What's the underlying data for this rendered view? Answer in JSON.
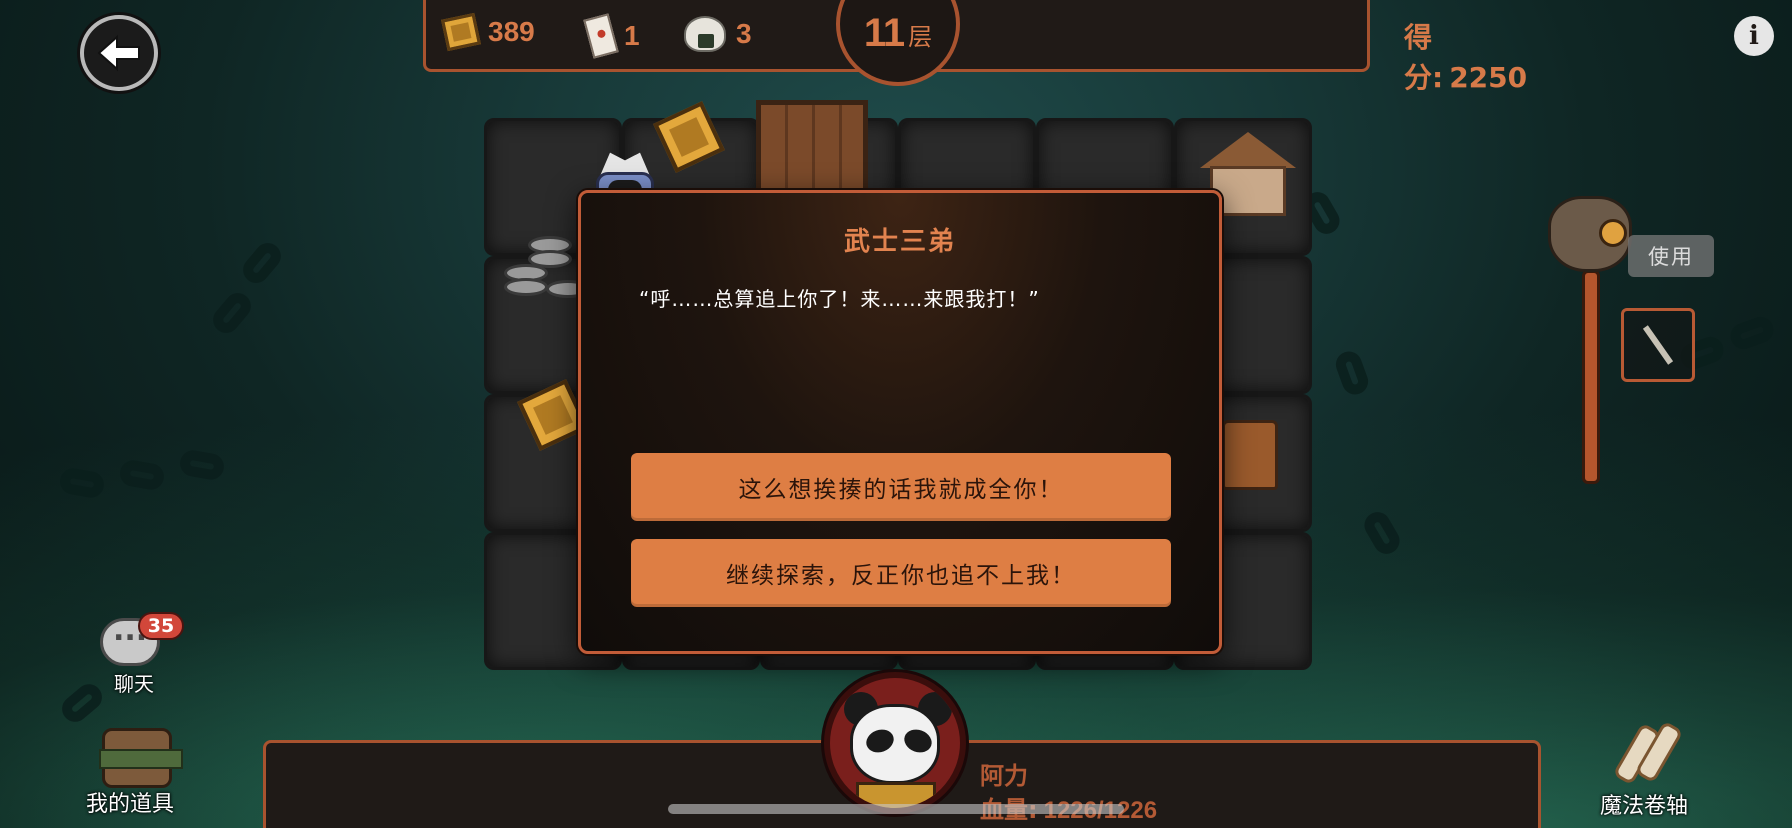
{
  "header": {
    "resources": [
      {
        "name": "gold",
        "value": "389"
      },
      {
        "name": "scroll",
        "value": "1"
      },
      {
        "name": "rice-ball",
        "value": "3"
      }
    ],
    "level_number": "11",
    "level_unit": "层",
    "score_label": "得分:",
    "score_value": "2250"
  },
  "dialog": {
    "title": "武士三弟",
    "message": "“呼……总算追上你了！来……来跟我打！”",
    "option_1": "这么想挨揍的话我就成全你！",
    "option_2": "继续探索，反正你也追不上我！"
  },
  "right_panel": {
    "use_label": "使用"
  },
  "left_panel": {
    "chat_label": "聊天",
    "chat_badge": "35",
    "items_label": "我的道具"
  },
  "bottom": {
    "magic_scroll_label": "魔法卷轴",
    "hero_name": "阿力",
    "hp_label": "血量:",
    "hp_value": "1226/1226"
  },
  "colors": {
    "accent": "#de7e44",
    "border": "#a8532f",
    "title": "#e2834f"
  },
  "icons": [
    "back-arrow-icon",
    "gold-icon",
    "scroll-icon",
    "rice-ball-icon",
    "info-icon",
    "chat-icon",
    "backpack-icon",
    "magic-scroll-icon"
  ]
}
